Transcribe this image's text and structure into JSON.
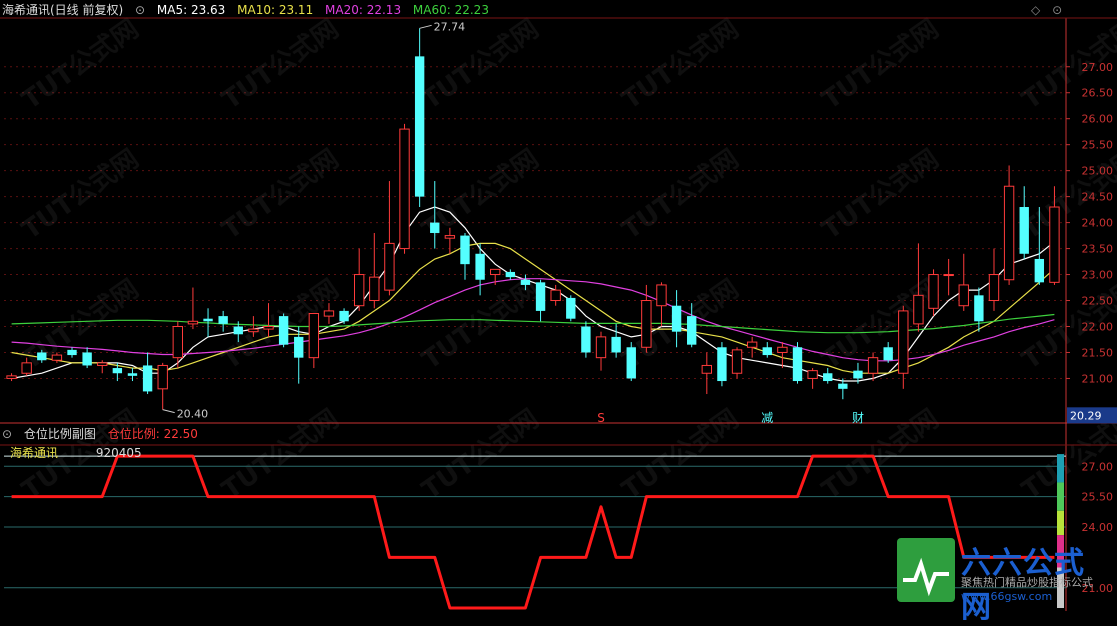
{
  "header": {
    "stock_title": "海希通讯(日线 前复权)",
    "ma": [
      {
        "label": "MA5: 23.63",
        "color": "#ffffff"
      },
      {
        "label": "MA10: 23.11",
        "color": "#e8e04a"
      },
      {
        "label": "MA20: 22.13",
        "color": "#e040e0"
      },
      {
        "label": "MA60: 22.23",
        "color": "#3dd13d"
      }
    ]
  },
  "sub_header": {
    "title": "仓位比例副图",
    "indicator": "仓位比例: 22.50",
    "legend_name": "海希通讯",
    "legend_code": "920405"
  },
  "annotations": {
    "high_label": "27.74",
    "low_label": "20.40",
    "price_tag": "20.29",
    "marker_s": "S",
    "marker_reduce": "减",
    "marker_cai": "财"
  },
  "watermark": "TUT公式网",
  "logo": {
    "title": "六六公式网",
    "subtitle": "聚焦热门精品炒股指标公式",
    "url": "www.66gsw.com"
  },
  "colors": {
    "up": "#ff3b3b",
    "down": "#54ffff",
    "ma5": "#ffffff",
    "ma10": "#e8e04a",
    "ma20": "#e040e0",
    "ma60": "#3dd13d",
    "position": "#ff1a1a",
    "axis": "#c83232"
  },
  "chart_data": [
    {
      "type": "candlestick",
      "title": "海希通讯(日线 前复权)",
      "y_ticks": [
        21.0,
        21.5,
        22.0,
        22.5,
        23.0,
        23.5,
        24.0,
        24.5,
        25.0,
        25.5,
        26.0,
        26.5,
        27.0
      ],
      "ylim": [
        20.2,
        27.9
      ],
      "grid": true,
      "candles": [
        {
          "o": 21.0,
          "h": 21.1,
          "l": 20.95,
          "c": 21.05
        },
        {
          "o": 21.1,
          "h": 21.4,
          "l": 21.05,
          "c": 21.3
        },
        {
          "o": 21.5,
          "h": 21.55,
          "l": 21.3,
          "c": 21.35
        },
        {
          "o": 21.35,
          "h": 21.5,
          "l": 21.3,
          "c": 21.45
        },
        {
          "o": 21.55,
          "h": 21.6,
          "l": 21.4,
          "c": 21.45
        },
        {
          "o": 21.5,
          "h": 21.6,
          "l": 21.2,
          "c": 21.25
        },
        {
          "o": 21.25,
          "h": 21.35,
          "l": 21.1,
          "c": 21.3
        },
        {
          "o": 21.2,
          "h": 21.3,
          "l": 20.95,
          "c": 21.1
        },
        {
          "o": 21.1,
          "h": 21.2,
          "l": 20.95,
          "c": 21.05
        },
        {
          "o": 21.25,
          "h": 21.5,
          "l": 20.7,
          "c": 20.75
        },
        {
          "o": 20.8,
          "h": 21.3,
          "l": 20.4,
          "c": 21.25
        },
        {
          "o": 21.4,
          "h": 22.1,
          "l": 21.2,
          "c": 22.0
        },
        {
          "o": 22.05,
          "h": 22.75,
          "l": 21.95,
          "c": 22.1
        },
        {
          "o": 22.15,
          "h": 22.35,
          "l": 21.8,
          "c": 22.1
        },
        {
          "o": 22.2,
          "h": 22.3,
          "l": 21.9,
          "c": 22.05
        },
        {
          "o": 22.0,
          "h": 22.1,
          "l": 21.7,
          "c": 21.85
        },
        {
          "o": 21.9,
          "h": 22.2,
          "l": 21.8,
          "c": 21.95
        },
        {
          "o": 21.95,
          "h": 22.45,
          "l": 21.8,
          "c": 22.0
        },
        {
          "o": 22.2,
          "h": 22.25,
          "l": 21.6,
          "c": 21.65
        },
        {
          "o": 21.8,
          "h": 22.0,
          "l": 20.9,
          "c": 21.4
        },
        {
          "o": 21.4,
          "h": 22.2,
          "l": 21.2,
          "c": 22.25
        },
        {
          "o": 22.2,
          "h": 22.45,
          "l": 22.05,
          "c": 22.3
        },
        {
          "o": 22.3,
          "h": 22.35,
          "l": 22.05,
          "c": 22.1
        },
        {
          "o": 22.4,
          "h": 23.5,
          "l": 22.3,
          "c": 23.0
        },
        {
          "o": 22.5,
          "h": 23.8,
          "l": 22.35,
          "c": 22.95
        },
        {
          "o": 22.7,
          "h": 24.8,
          "l": 22.6,
          "c": 23.6
        },
        {
          "o": 23.5,
          "h": 25.9,
          "l": 23.4,
          "c": 25.8
        },
        {
          "o": 27.2,
          "h": 27.74,
          "l": 24.3,
          "c": 24.5
        },
        {
          "o": 24.0,
          "h": 24.8,
          "l": 23.5,
          "c": 23.8
        },
        {
          "o": 23.7,
          "h": 23.9,
          "l": 23.4,
          "c": 23.75
        },
        {
          "o": 23.75,
          "h": 23.8,
          "l": 22.9,
          "c": 23.2
        },
        {
          "o": 23.4,
          "h": 23.6,
          "l": 22.6,
          "c": 22.9
        },
        {
          "o": 23.0,
          "h": 23.1,
          "l": 22.8,
          "c": 23.1
        },
        {
          "o": 23.05,
          "h": 23.1,
          "l": 22.9,
          "c": 22.95
        },
        {
          "o": 22.9,
          "h": 23.0,
          "l": 22.7,
          "c": 22.8
        },
        {
          "o": 22.85,
          "h": 22.9,
          "l": 22.1,
          "c": 22.3
        },
        {
          "o": 22.5,
          "h": 22.8,
          "l": 22.4,
          "c": 22.7
        },
        {
          "o": 22.55,
          "h": 22.6,
          "l": 22.1,
          "c": 22.15
        },
        {
          "o": 22.0,
          "h": 22.1,
          "l": 21.4,
          "c": 21.5
        },
        {
          "o": 21.4,
          "h": 21.9,
          "l": 21.15,
          "c": 21.8
        },
        {
          "o": 21.8,
          "h": 22.05,
          "l": 21.4,
          "c": 21.5
        },
        {
          "o": 21.6,
          "h": 21.7,
          "l": 20.95,
          "c": 21.0
        },
        {
          "o": 21.6,
          "h": 22.8,
          "l": 21.5,
          "c": 22.5
        },
        {
          "o": 22.4,
          "h": 22.85,
          "l": 22.0,
          "c": 22.8
        },
        {
          "o": 22.4,
          "h": 22.7,
          "l": 21.6,
          "c": 21.9
        },
        {
          "o": 22.2,
          "h": 22.45,
          "l": 21.6,
          "c": 21.65
        },
        {
          "o": 21.1,
          "h": 21.5,
          "l": 20.7,
          "c": 21.25
        },
        {
          "o": 21.6,
          "h": 21.7,
          "l": 20.85,
          "c": 20.95
        },
        {
          "o": 21.1,
          "h": 21.6,
          "l": 21.0,
          "c": 21.55
        },
        {
          "o": 21.6,
          "h": 21.8,
          "l": 21.4,
          "c": 21.7
        },
        {
          "o": 21.6,
          "h": 21.7,
          "l": 21.4,
          "c": 21.45
        },
        {
          "o": 21.5,
          "h": 21.7,
          "l": 21.2,
          "c": 21.6
        },
        {
          "o": 21.6,
          "h": 21.7,
          "l": 20.9,
          "c": 20.95
        },
        {
          "o": 21.0,
          "h": 21.2,
          "l": 20.8,
          "c": 21.15
        },
        {
          "o": 21.1,
          "h": 21.2,
          "l": 20.9,
          "c": 20.95
        },
        {
          "o": 20.9,
          "h": 21.0,
          "l": 20.6,
          "c": 20.8
        },
        {
          "o": 21.15,
          "h": 21.3,
          "l": 20.9,
          "c": 21.0
        },
        {
          "o": 21.1,
          "h": 21.5,
          "l": 20.95,
          "c": 21.4
        },
        {
          "o": 21.6,
          "h": 21.7,
          "l": 21.3,
          "c": 21.35
        },
        {
          "o": 21.1,
          "h": 22.4,
          "l": 20.8,
          "c": 22.3
        },
        {
          "o": 22.05,
          "h": 23.6,
          "l": 21.9,
          "c": 22.6
        },
        {
          "o": 22.35,
          "h": 23.1,
          "l": 22.2,
          "c": 23.0
        },
        {
          "o": 23.0,
          "h": 23.3,
          "l": 22.6,
          "c": 23.0
        },
        {
          "o": 22.4,
          "h": 23.4,
          "l": 22.3,
          "c": 22.8
        },
        {
          "o": 22.6,
          "h": 22.75,
          "l": 21.9,
          "c": 22.1
        },
        {
          "o": 22.5,
          "h": 23.5,
          "l": 22.3,
          "c": 23.0
        },
        {
          "o": 22.9,
          "h": 25.1,
          "l": 22.8,
          "c": 24.7
        },
        {
          "o": 24.3,
          "h": 24.7,
          "l": 23.3,
          "c": 23.4
        },
        {
          "o": 23.3,
          "h": 24.3,
          "l": 22.8,
          "c": 22.85
        },
        {
          "o": 22.85,
          "h": 24.7,
          "l": 22.8,
          "c": 24.3
        }
      ],
      "series": [
        {
          "name": "MA5",
          "values": [
            21.0,
            21.05,
            21.1,
            21.2,
            21.3,
            21.3,
            21.3,
            21.3,
            21.25,
            21.1,
            21.1,
            21.3,
            21.6,
            21.8,
            21.85,
            21.9,
            21.95,
            22.0,
            22.0,
            21.9,
            21.85,
            22.0,
            22.1,
            22.4,
            22.8,
            23.2,
            23.8,
            24.2,
            24.3,
            24.2,
            23.9,
            23.5,
            23.2,
            23.0,
            22.9,
            22.8,
            22.7,
            22.5,
            22.2,
            22.0,
            21.9,
            21.8,
            21.85,
            22.0,
            22.0,
            21.9,
            21.7,
            21.5,
            21.4,
            21.35,
            21.3,
            21.25,
            21.2,
            21.1,
            21.0,
            20.95,
            20.95,
            21.0,
            21.1,
            21.4,
            21.8,
            22.2,
            22.5,
            22.7,
            22.7,
            22.9,
            23.2,
            23.3,
            23.4,
            23.63
          ]
        },
        {
          "name": "MA10",
          "values": [
            21.5,
            21.45,
            21.4,
            21.35,
            21.3,
            21.3,
            21.3,
            21.25,
            21.2,
            21.2,
            21.15,
            21.2,
            21.3,
            21.4,
            21.5,
            21.6,
            21.7,
            21.8,
            21.85,
            21.85,
            21.85,
            21.9,
            21.95,
            22.1,
            22.3,
            22.5,
            22.8,
            23.1,
            23.3,
            23.4,
            23.55,
            23.6,
            23.6,
            23.5,
            23.3,
            23.1,
            22.9,
            22.7,
            22.5,
            22.3,
            22.1,
            22.0,
            21.95,
            21.95,
            21.95,
            21.9,
            21.85,
            21.8,
            21.7,
            21.6,
            21.5,
            21.4,
            21.35,
            21.3,
            21.25,
            21.15,
            21.1,
            21.1,
            21.1,
            21.2,
            21.3,
            21.45,
            21.6,
            21.8,
            21.95,
            22.1,
            22.35,
            22.6,
            22.85,
            23.11
          ]
        },
        {
          "name": "MA20",
          "values": [
            21.7,
            21.68,
            21.65,
            21.62,
            21.6,
            21.58,
            21.56,
            21.53,
            21.5,
            21.48,
            21.46,
            21.46,
            21.48,
            21.5,
            21.52,
            21.55,
            21.58,
            21.62,
            21.66,
            21.7,
            21.74,
            21.78,
            21.82,
            21.88,
            21.96,
            22.06,
            22.18,
            22.32,
            22.46,
            22.58,
            22.7,
            22.8,
            22.86,
            22.9,
            22.92,
            22.92,
            22.9,
            22.88,
            22.86,
            22.82,
            22.76,
            22.7,
            22.6,
            22.48,
            22.35,
            22.22,
            22.1,
            22.0,
            21.92,
            21.84,
            21.76,
            21.68,
            21.6,
            21.52,
            21.46,
            21.4,
            21.36,
            21.34,
            21.34,
            21.36,
            21.4,
            21.46,
            21.54,
            21.64,
            21.72,
            21.8,
            21.9,
            21.98,
            22.05,
            22.13
          ]
        },
        {
          "name": "MA60",
          "values": [
            22.05,
            22.06,
            22.07,
            22.08,
            22.09,
            22.1,
            22.11,
            22.12,
            22.12,
            22.12,
            22.11,
            22.1,
            22.08,
            22.07,
            22.05,
            22.04,
            22.03,
            22.02,
            22.01,
            22.0,
            22.0,
            22.0,
            22.01,
            22.03,
            22.05,
            22.07,
            22.09,
            22.11,
            22.12,
            22.13,
            22.13,
            22.13,
            22.12,
            22.11,
            22.1,
            22.09,
            22.08,
            22.07,
            22.06,
            22.06,
            22.06,
            22.06,
            22.06,
            22.06,
            22.05,
            22.04,
            22.02,
            22.0,
            21.98,
            21.96,
            21.94,
            21.92,
            21.9,
            21.89,
            21.88,
            21.88,
            21.88,
            21.89,
            21.9,
            21.92,
            21.94,
            21.96,
            21.99,
            22.02,
            22.06,
            22.1,
            22.14,
            22.17,
            22.2,
            22.23
          ]
        }
      ]
    },
    {
      "type": "line",
      "title": "仓位比例副图",
      "y_ticks": [
        21.0,
        24.0,
        25.5,
        27.0
      ],
      "ylim": [
        20.0,
        28.0
      ],
      "series": [
        {
          "name": "仓位比例",
          "values": [
            25.5,
            25.5,
            25.5,
            25.5,
            25.5,
            25.5,
            25.5,
            27.5,
            27.5,
            27.5,
            27.5,
            27.5,
            27.5,
            25.5,
            25.5,
            25.5,
            25.5,
            25.5,
            25.5,
            25.5,
            25.5,
            25.5,
            25.5,
            25.5,
            25.5,
            22.5,
            22.5,
            22.5,
            22.5,
            20.0,
            20.0,
            20.0,
            20.0,
            20.0,
            20.0,
            22.5,
            22.5,
            22.5,
            22.5,
            25.0,
            22.5,
            22.5,
            25.5,
            25.5,
            25.5,
            25.5,
            25.5,
            25.5,
            25.5,
            25.5,
            25.5,
            25.5,
            25.5,
            27.5,
            27.5,
            27.5,
            27.5,
            27.5,
            25.5,
            25.5,
            25.5,
            25.5,
            25.5,
            22.5,
            22.5,
            22.5,
            22.5,
            22.5,
            22.5,
            22.5
          ]
        }
      ]
    }
  ]
}
